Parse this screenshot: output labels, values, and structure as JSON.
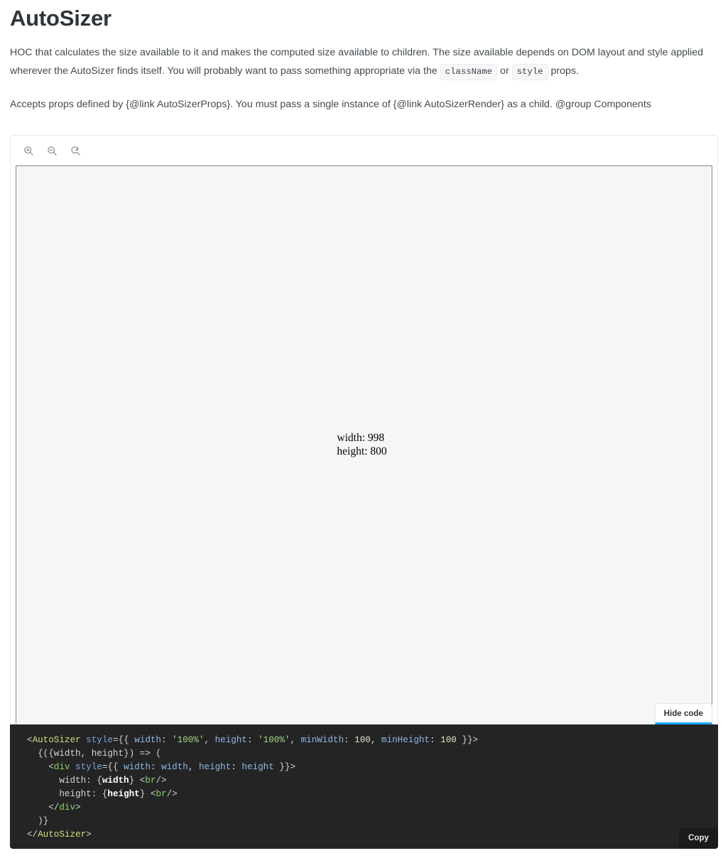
{
  "doc": {
    "title": "AutoSizer",
    "paragraph1_part1": "HOC that calculates the size available to it and makes the computed size available to children. The size available depends on DOM layout and style applied wherever the AutoSizer finds itself. You will probably want to pass something appropriate via the ",
    "chip_classname": "className",
    "paragraph1_or": " or ",
    "chip_style": "style",
    "paragraph1_end": " props.",
    "paragraph2": "Accepts props defined by {@link AutoSizerProps}. You must pass a single instance of {@link AutoSizerRender} as a child. @group Components"
  },
  "toolbar": {
    "zoom_in_icon": "zoom-in-icon",
    "zoom_out_icon": "zoom-out-icon",
    "zoom_reset_icon": "zoom-reset-icon"
  },
  "preview": {
    "width_label": "width: 998",
    "height_label": "height: 800",
    "measured_width": 998,
    "measured_height": 800,
    "background_color": "#f6f6f6"
  },
  "actions": {
    "hide_code_label": "Hide code",
    "copy_label": "Copy",
    "accent_color": "#1ea7fd"
  },
  "code": {
    "language": "jsx",
    "lines": [
      "<AutoSizer style={{ width: '100%', height: '100%', minWidth: 100, minHeight: 100 }}>",
      "  {({width, height}) => (",
      "    <div style={{ width: width, height: height }}>",
      "      width: {width} <br/>",
      "      height: {height} <br/>",
      "    </div>",
      "  )}",
      "</AutoSizer>"
    ]
  }
}
